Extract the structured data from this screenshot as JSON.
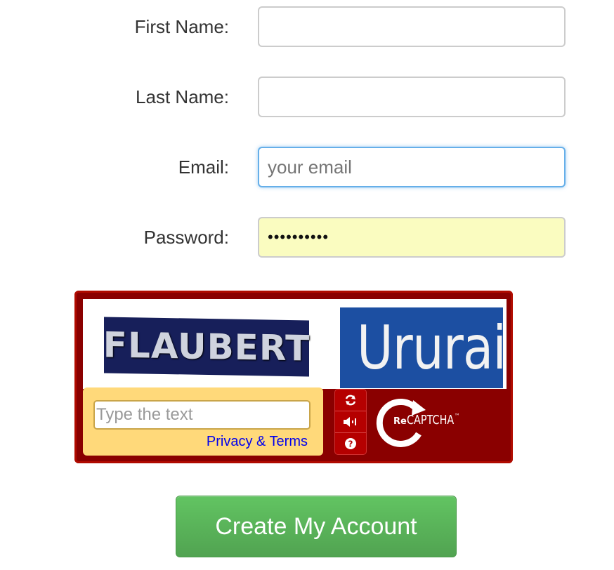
{
  "form": {
    "first_name_label": "First Name:",
    "first_name_value": "",
    "last_name_label": "Last Name:",
    "last_name_value": "",
    "email_label": "Email:",
    "email_placeholder": "your email",
    "email_value": "",
    "password_label": "Password:",
    "password_value": "••••••••••",
    "submit_label": "Create My Account"
  },
  "captcha": {
    "word1": "FLAUBERT",
    "word2": "Ururai",
    "input_placeholder": "Type the text",
    "privacy_link": "Privacy & Terms",
    "logo_re": "Re",
    "logo_captcha": "CAPTCHA",
    "logo_tm": "™",
    "buttons": [
      "refresh-icon",
      "audio-icon",
      "help-icon"
    ]
  },
  "colors": {
    "field_border": "#cccccc",
    "focus_border": "#66afe9",
    "autofill_bg": "#fafcc0",
    "captcha_bg": "#8a0000",
    "captcha_input_bg": "#ffd97a",
    "submit_bg": "#5cb85c"
  }
}
